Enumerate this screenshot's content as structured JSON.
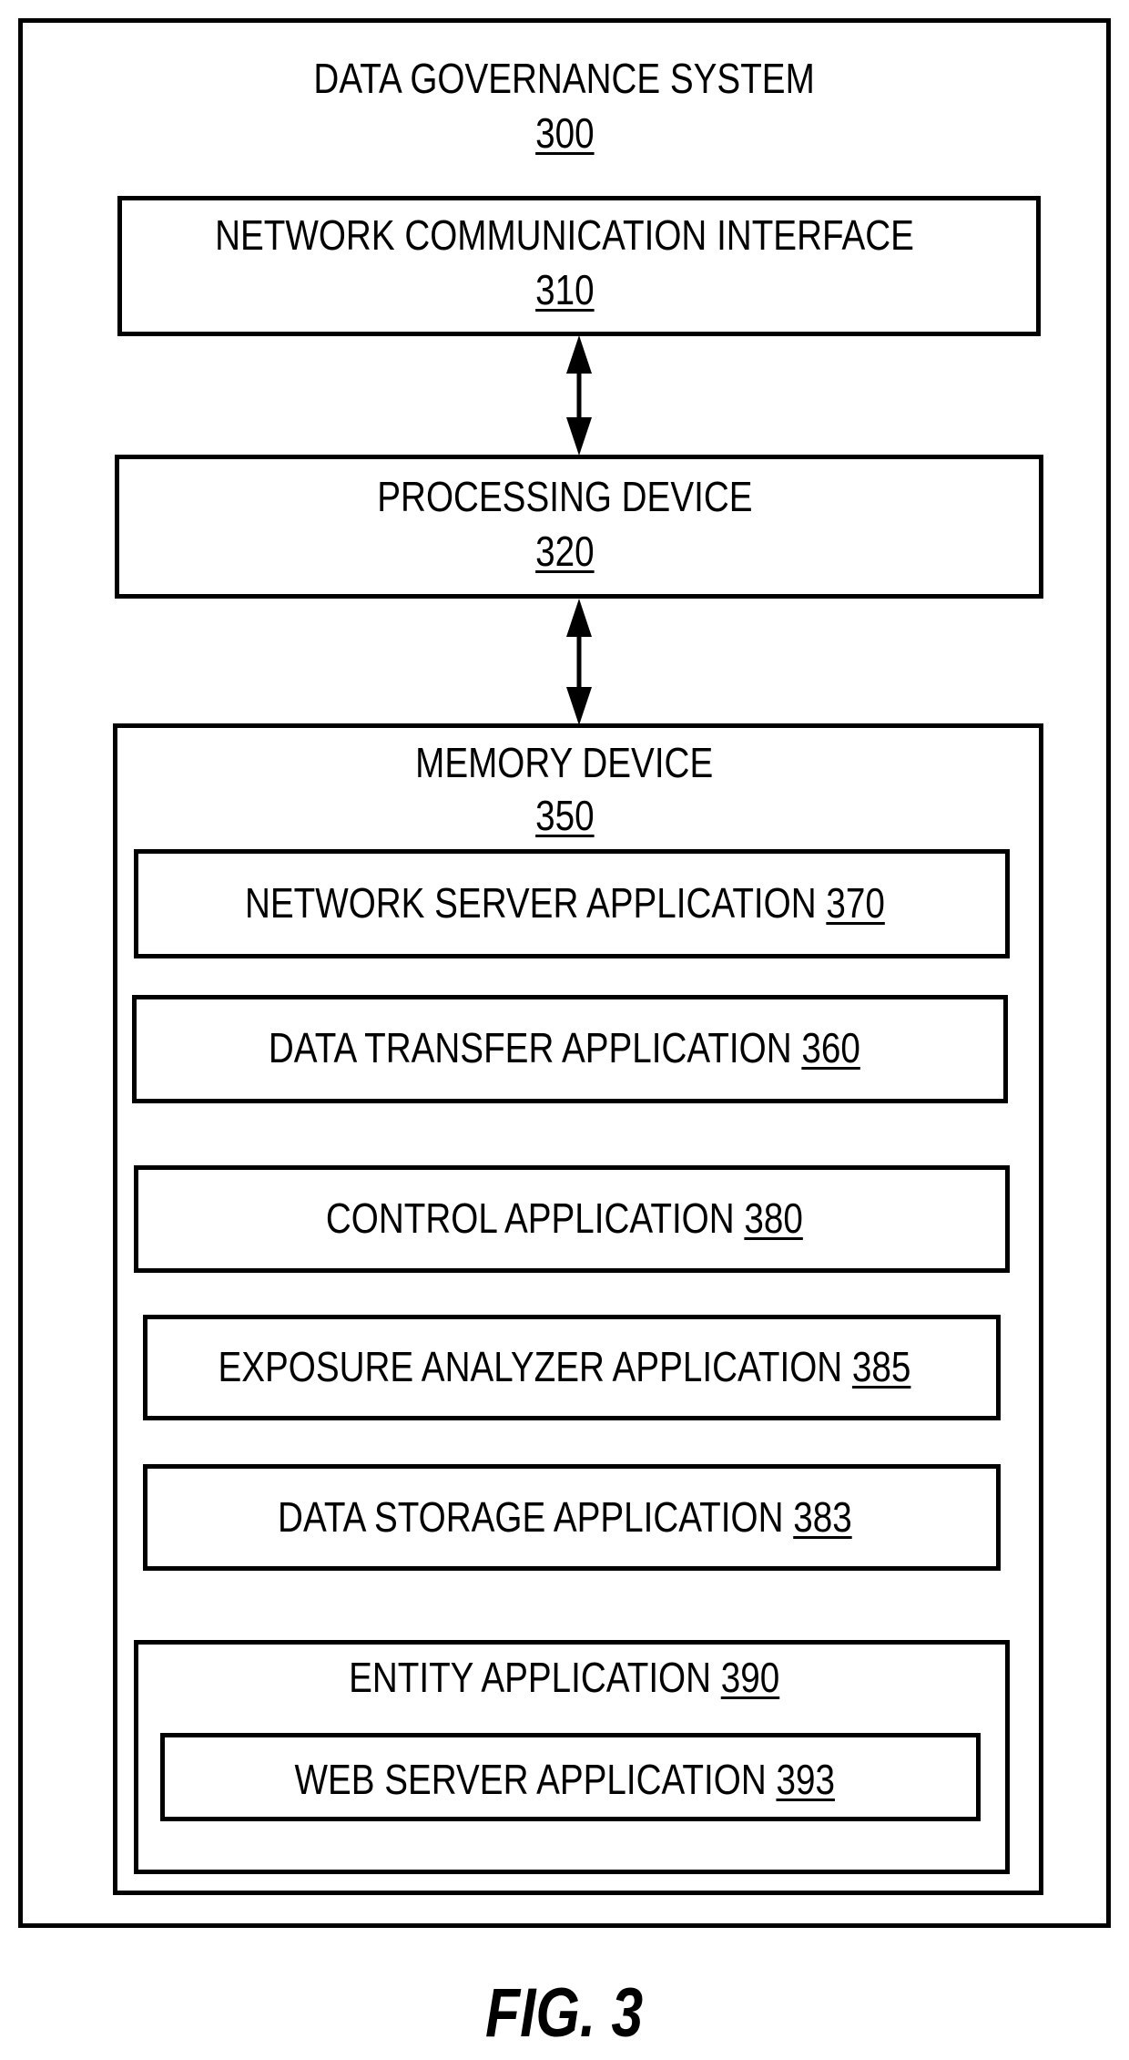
{
  "figure": {
    "caption": "FIG. 3"
  },
  "system": {
    "title": "DATA GOVERNANCE SYSTEM",
    "ref": "300"
  },
  "network_interface": {
    "title": "NETWORK COMMUNICATION INTERFACE",
    "ref": "310"
  },
  "processing_device": {
    "title": "PROCESSING DEVICE",
    "ref": "320"
  },
  "memory_device": {
    "title": "MEMORY DEVICE",
    "ref": "350",
    "applications": [
      {
        "title": "NETWORK SERVER APPLICATION",
        "ref": "370"
      },
      {
        "title": "DATA TRANSFER APPLICATION",
        "ref": "360"
      },
      {
        "title": "CONTROL APPLICATION",
        "ref": "380"
      },
      {
        "title": "EXPOSURE ANALYZER APPLICATION",
        "ref": "385"
      },
      {
        "title": "DATA STORAGE APPLICATION",
        "ref": "383"
      }
    ],
    "entity_application": {
      "title": "ENTITY APPLICATION",
      "ref": "390",
      "sub_application": {
        "title": "WEB SERVER APPLICATION",
        "ref": "393"
      }
    }
  },
  "connections": [
    {
      "from": "network_interface",
      "to": "processing_device",
      "type": "bidirectional"
    },
    {
      "from": "processing_device",
      "to": "memory_device",
      "type": "bidirectional"
    }
  ]
}
